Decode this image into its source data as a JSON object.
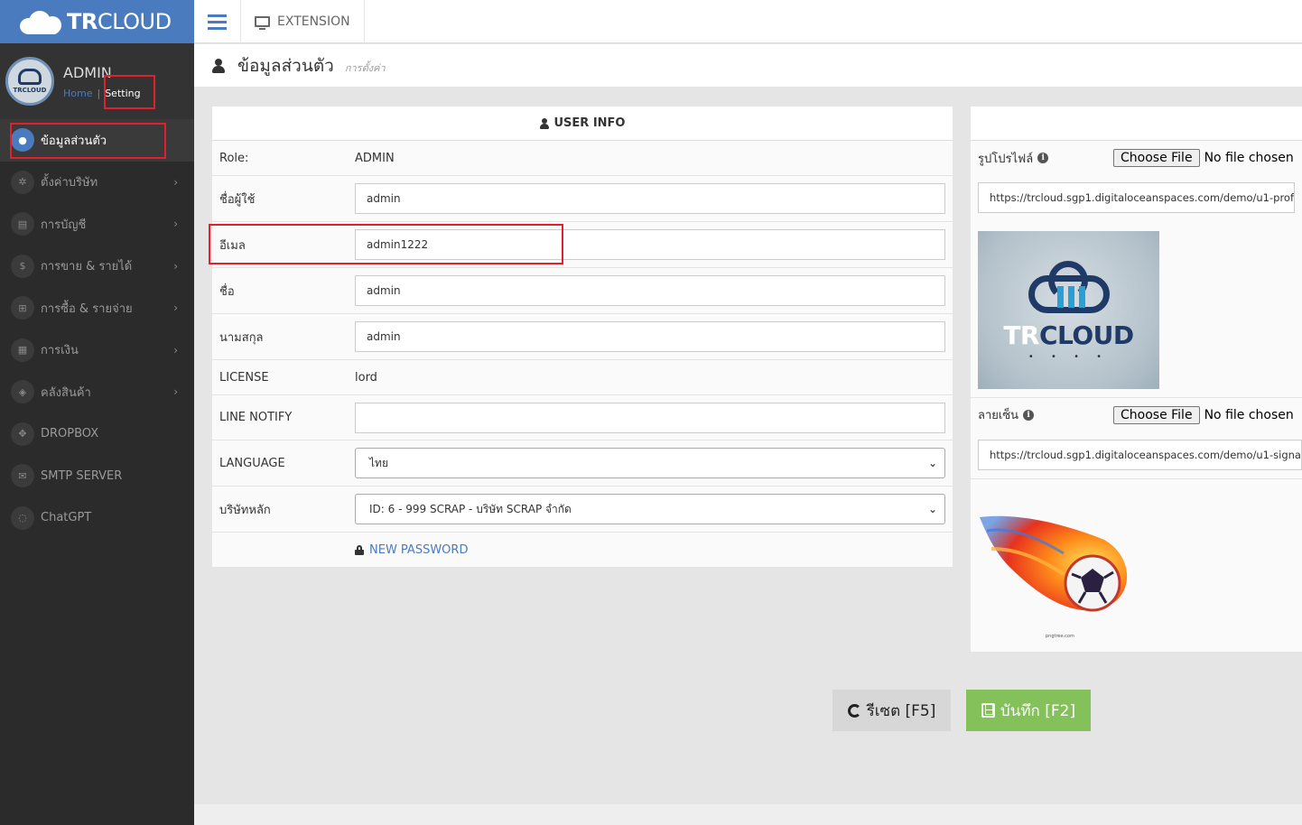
{
  "brand": {
    "name_bold": "TR",
    "name_rest": "CLOUD"
  },
  "profile": {
    "name": "ADMIN",
    "home_link": "Home",
    "separator": "|",
    "setting_link": "Setting",
    "avatar_text": "TRCLOUD"
  },
  "sidebar": {
    "items": [
      {
        "label": "ข้อมูลส่วนตัว",
        "icon": "user-icon",
        "glyph": "●",
        "active": true,
        "arrow": false
      },
      {
        "label": "ตั้งค่าบริษัท",
        "icon": "gear-icon",
        "glyph": "✲",
        "arrow": true
      },
      {
        "label": "การบัญชี",
        "icon": "book-icon",
        "glyph": "▤",
        "arrow": true
      },
      {
        "label": "การขาย & รายได้",
        "icon": "dollar-icon",
        "glyph": "$",
        "arrow": true
      },
      {
        "label": "การซื้อ & รายจ่าย",
        "icon": "cart-icon",
        "glyph": "⊞",
        "arrow": true
      },
      {
        "label": "การเงิน",
        "icon": "calendar-icon",
        "glyph": "▦",
        "arrow": true
      },
      {
        "label": "คลังสินค้า",
        "icon": "cube-icon",
        "glyph": "◈",
        "arrow": true
      },
      {
        "label": "DROPBOX",
        "icon": "dropbox-icon",
        "glyph": "✥",
        "arrow": false
      },
      {
        "label": "SMTP SERVER",
        "icon": "envelope-icon",
        "glyph": "✉",
        "arrow": false
      },
      {
        "label": "ChatGPT",
        "icon": "comment-icon",
        "glyph": "◌",
        "arrow": false
      }
    ],
    "arrow_glyph": "›"
  },
  "topbar": {
    "extension_label": "EXTENSION"
  },
  "header": {
    "title": "ข้อมูลส่วนตัว",
    "subtitle": "การตั้งค่า"
  },
  "user_info": {
    "heading": "USER INFO",
    "role_label": "Role:",
    "role_value": "ADMIN",
    "username_label": "ชื่อผู้ใช้",
    "username_value": "admin",
    "email_label": "อีเมล",
    "email_value": "admin1222",
    "firstname_label": "ชื่อ",
    "firstname_value": "admin",
    "lastname_label": "นามสกุล",
    "lastname_value": "admin",
    "license_label": "LICENSE",
    "license_value": "lord",
    "line_notify_label": "LINE NOTIFY",
    "line_notify_value": "",
    "language_label": "LANGUAGE",
    "language_value": "ไทย",
    "company_label": "บริษัทหลัก",
    "company_value": "ID: 6 - 999 SCRAP - บริษัท SCRAP จำกัด",
    "new_password_label": "NEW PASSWORD"
  },
  "files": {
    "profile_label": "รูปโปรไฟล์",
    "profile_url": "https://trcloud.sgp1.digitaloceanspaces.com/demo/u1-profile",
    "signature_label": "ลายเซ็น",
    "signature_url": "https://trcloud.sgp1.digitaloceanspaces.com/demo/u1-signa",
    "choose_file_label": "Choose File",
    "no_file_text": "No file chosen",
    "logo_word_tr": "TR",
    "logo_word_rest": "CLOUD",
    "signature_caption": "pngtree.com"
  },
  "actions": {
    "reset_label": "รีเซต [F5]",
    "save_label": "บันทึก [F2]"
  },
  "colors": {
    "brand": "#4a7bbf",
    "sidebar": "#2b2b2b",
    "save": "#84c15a",
    "highlight": "#e0202a"
  }
}
